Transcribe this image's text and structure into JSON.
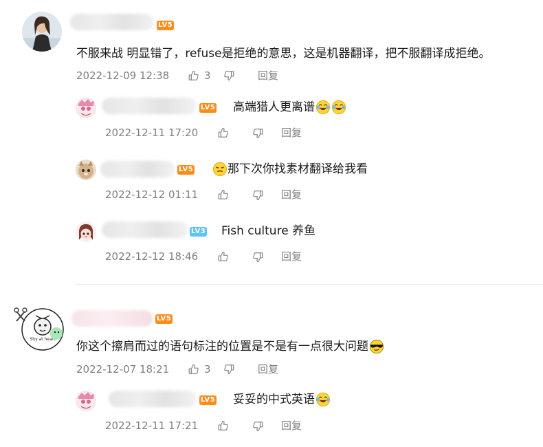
{
  "comments": [
    {
      "level": "LV5",
      "text": "不服来战 明显错了，refuse是拒绝的意思，这是机器翻译，把不服翻译成拒绝。",
      "time": "2022-12-09 12:38",
      "likes": "3",
      "reply_label": "回复",
      "replies": [
        {
          "level": "LV5",
          "text": "高端猎人更离谱",
          "time": "2022-12-11 17:20",
          "reply_label": "回复"
        },
        {
          "level": "LV5",
          "text": "那下次你找素材翻译给我看",
          "time": "2022-12-12 01:11",
          "reply_label": "回复"
        },
        {
          "level": "LV3",
          "text": "Fish culture 养鱼",
          "time": "2022-12-12 18:46",
          "reply_label": "回复"
        }
      ]
    },
    {
      "level": "LV5",
      "text": "你这个擦肩而过的语句标注的位置是不是有一点很大问题",
      "time": "2022-12-07 18:21",
      "likes": "3",
      "reply_label": "回复",
      "replies": [
        {
          "level": "LV5",
          "text": "妥妥的中式英语",
          "time": "2022-12-11 17:21",
          "reply_label": "回复"
        }
      ]
    }
  ],
  "icons": {
    "like": "thumbs-up-icon",
    "dislike": "thumbs-down-icon",
    "laugh_cry": "laugh-cry-emoji",
    "hmph": "hmph-emoji",
    "sunglasses": "sunglasses-emoji"
  },
  "colors": {
    "level_orange": "#ff8c1a",
    "level_blue": "#5ec3f5",
    "meta_gray": "#808080",
    "text": "#1a1a1a"
  }
}
